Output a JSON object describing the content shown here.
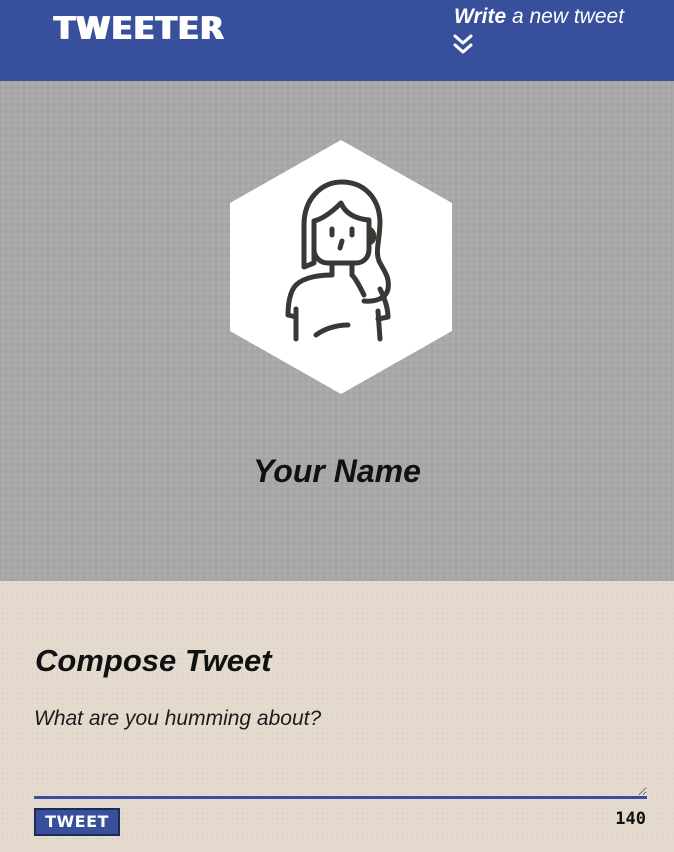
{
  "header": {
    "brand": "TWEETER",
    "write_bold": "Write",
    "write_rest": " a new tweet",
    "expand_icon": "double-chevron-down-icon"
  },
  "profile": {
    "avatar_icon": "person-avatar-icon",
    "name": "Your Name"
  },
  "compose": {
    "title": "Compose Tweet",
    "placeholder": "What are you humming about?",
    "button_label": "TWEET",
    "char_count": "140"
  },
  "colors": {
    "primary": "#384f9b",
    "profile_bg": "#a9a8a6",
    "compose_bg": "#e4dace"
  }
}
